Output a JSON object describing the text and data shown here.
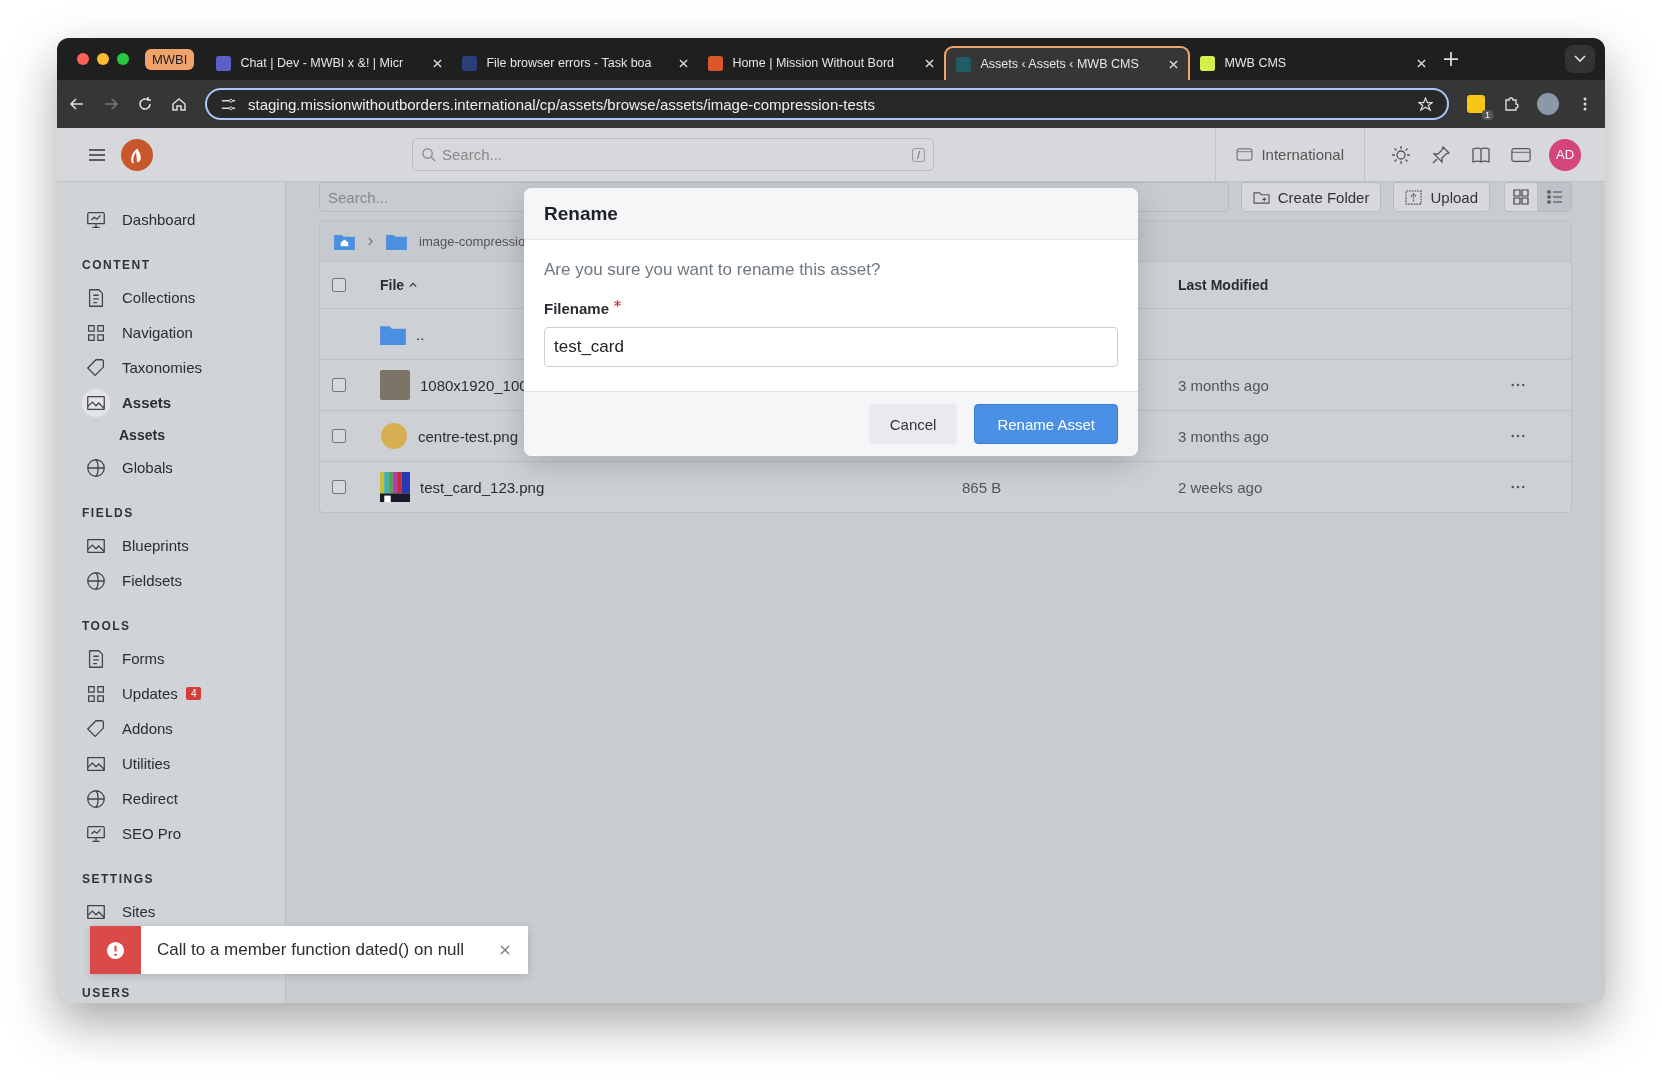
{
  "browser": {
    "group_label": "MWBI",
    "tabs": [
      {
        "label": "Chat | Dev - MWBI x &! | Micr",
        "selected": false
      },
      {
        "label": "File browser errors - Task boa",
        "selected": false
      },
      {
        "label": "Home | Mission Without Bord",
        "selected": false
      },
      {
        "label": "Assets ‹ Assets ‹ MWB CMS",
        "selected": true
      },
      {
        "label": "MWB CMS",
        "selected": false
      }
    ],
    "url": "staging.missionwithoutborders.international/cp/assets/browse/assets/image-compression-tests",
    "extension_badge": "1"
  },
  "header": {
    "search_placeholder": "Search...",
    "search_shortcut": "/",
    "site": "International",
    "avatar": "AD"
  },
  "sidebar": {
    "top_items": [
      {
        "label": "Dashboard",
        "selected": false
      }
    ],
    "sections": [
      {
        "heading": "CONTENT",
        "items": [
          {
            "label": "Collections",
            "selected": false
          },
          {
            "label": "Navigation",
            "selected": false
          },
          {
            "label": "Taxonomies",
            "selected": false
          },
          {
            "label": "Assets",
            "selected": true,
            "children": [
              {
                "label": "Assets",
                "selected": true
              }
            ]
          },
          {
            "label": "Globals",
            "selected": false
          }
        ]
      },
      {
        "heading": "FIELDS",
        "items": [
          {
            "label": "Blueprints",
            "selected": false
          },
          {
            "label": "Fieldsets",
            "selected": false
          }
        ]
      },
      {
        "heading": "TOOLS",
        "items": [
          {
            "label": "Forms",
            "selected": false
          },
          {
            "label": "Updates",
            "selected": false,
            "badge": "4"
          },
          {
            "label": "Addons",
            "selected": false
          },
          {
            "label": "Utilities",
            "selected": false
          },
          {
            "label": "Redirect",
            "selected": false
          },
          {
            "label": "SEO Pro",
            "selected": false
          }
        ]
      },
      {
        "heading": "SETTINGS",
        "items": [
          {
            "label": "Sites",
            "selected": false
          }
        ]
      },
      {
        "heading": "USERS"
      }
    ]
  },
  "toolbar": {
    "search_placeholder": "Search...",
    "buttons": [
      "Create Folder",
      "Upload"
    ],
    "views": [
      {
        "kind": "grid",
        "selected": false
      },
      {
        "kind": "list",
        "selected": true
      }
    ]
  },
  "browser_table": {
    "breadcrumb": "image-compressio",
    "columns": {
      "file": "File",
      "modified": "Last Modified"
    },
    "header_checked": false,
    "rows": [
      {
        "kind": "parent",
        "name": ".."
      },
      {
        "kind": "photo",
        "name": "1080x1920_100",
        "modified": "3 months ago",
        "checked": false
      },
      {
        "kind": "circle",
        "name": "centre-test.png",
        "modified": "3 months ago",
        "checked": false
      },
      {
        "kind": "testcard",
        "name": "test_card_123.png",
        "size": "865 B",
        "modified": "2 weeks ago",
        "checked": false
      }
    ]
  },
  "dialog": {
    "title": "Rename",
    "message": "Are you sure you want to rename this asset?",
    "field_label": "Filename",
    "required": true,
    "value": "test_card",
    "cancel": "Cancel",
    "confirm": "Rename Asset"
  },
  "toast": {
    "message": "Call to a member function dated() on null"
  }
}
